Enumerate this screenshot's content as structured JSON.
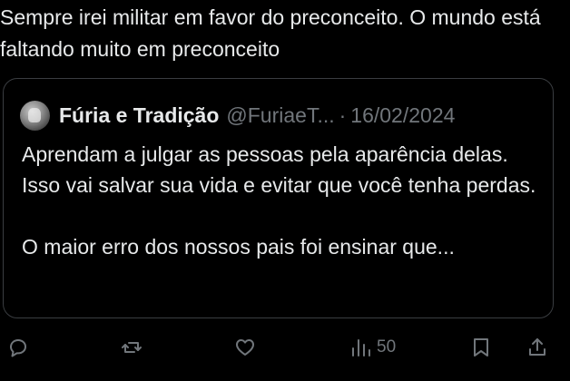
{
  "tweet": {
    "text": "Sempre irei militar em favor do preconceito. O mundo está faltando muito em preconceito"
  },
  "quote": {
    "author_name": "Fúria e Tradição",
    "handle": "@FuriaeT...",
    "separator": "·",
    "date": "16/02/2024",
    "paragraph_1": "Aprendam a julgar as pessoas pela aparência delas. Isso vai salvar sua vida e evitar que você tenha perdas.",
    "paragraph_2": "O maior erro dos nossos pais foi ensinar que..."
  },
  "actions": {
    "views_count": "50",
    "icons": [
      "reply-icon",
      "repost-icon",
      "like-icon",
      "views-icon",
      "bookmark-icon",
      "share-icon"
    ]
  },
  "colors": {
    "background": "#000000",
    "text": "#e7e9ea",
    "muted": "#71767b",
    "border": "#3a3d41"
  }
}
